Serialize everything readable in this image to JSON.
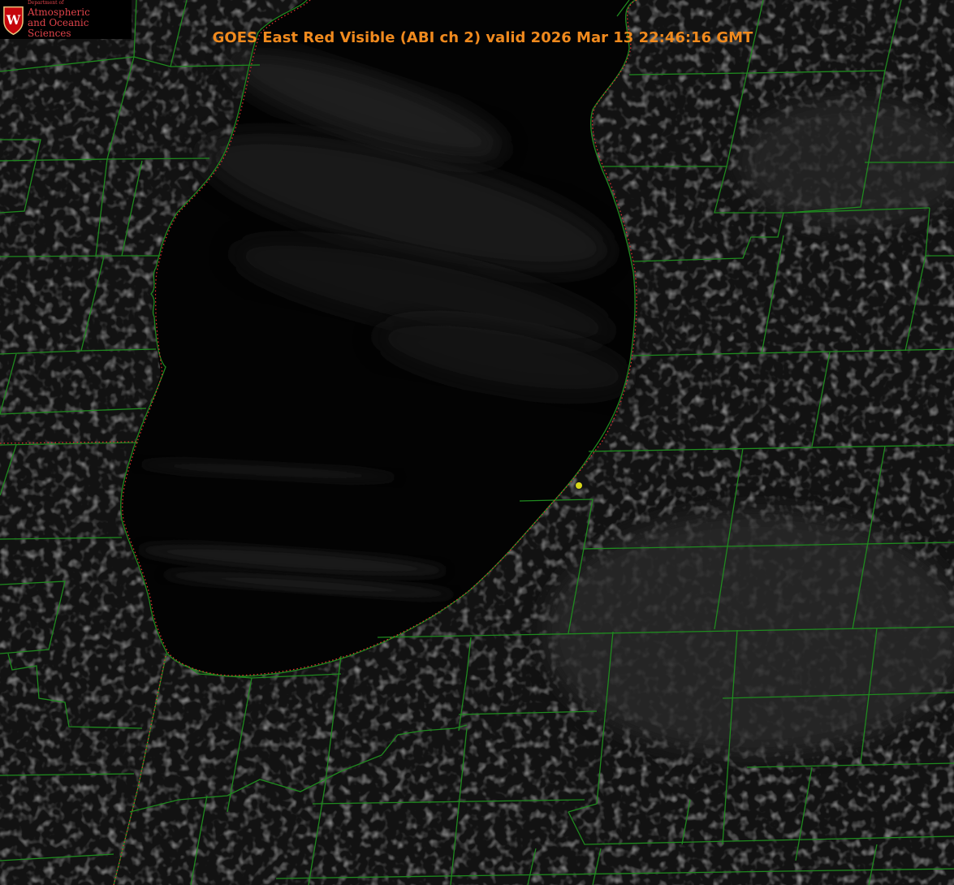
{
  "title": "GOES East Red Visible (ABI ch 2) valid 2026 Mar 13 22:46:16 GMT",
  "logo": {
    "letter": "W",
    "department": "Department of",
    "line1": "Atmospheric",
    "line2": "and Oceanic Sciences"
  },
  "colors": {
    "county_border": "#1f8a1f",
    "shoreline_dots": "#e03030",
    "marker": "#d8d81a",
    "title": "#f08a1e",
    "logo_red": "#c5050c",
    "lake": "#020202",
    "land": "#121212"
  }
}
